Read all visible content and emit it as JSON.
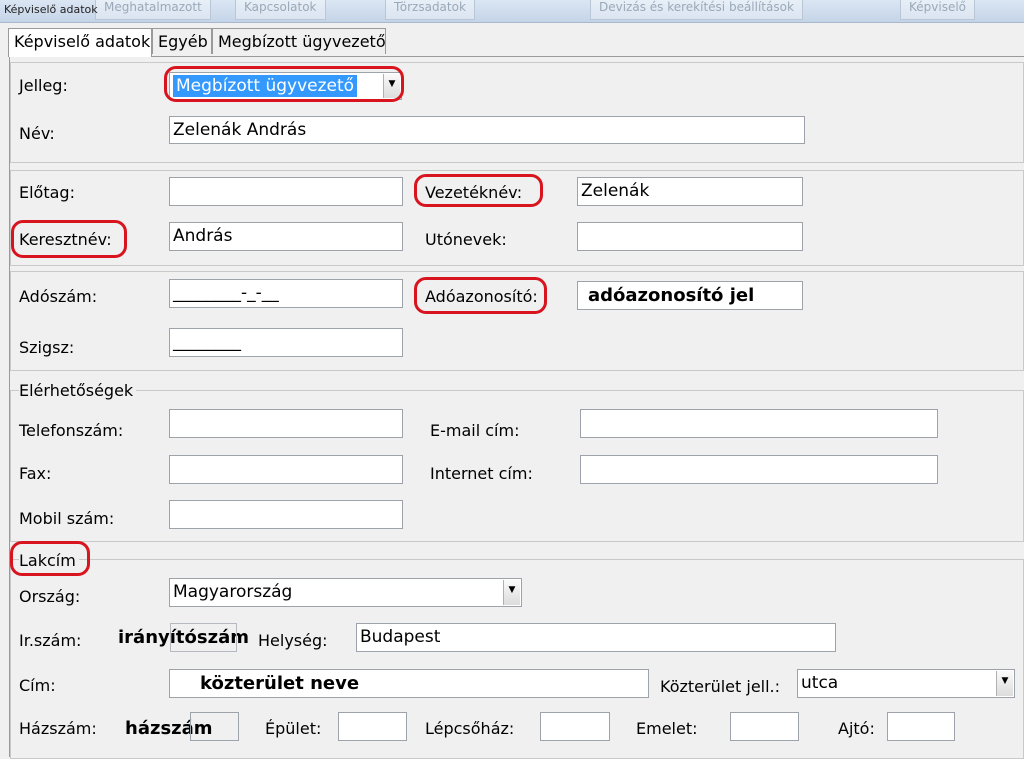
{
  "window": {
    "title": "Képviselő adatok",
    "background_tabs": [
      "Meghatalmazott",
      "Kapcsolatok",
      "Törzsadatok",
      "Devizás és kerekítési beállítások",
      "Képviselő"
    ]
  },
  "tabs": [
    {
      "label": "Képviselő adatok",
      "active": true
    },
    {
      "label": "Egyéb",
      "active": false
    },
    {
      "label": "Megbízott ügyvezető",
      "active": false
    }
  ],
  "general": {
    "jelleg_label": "Jelleg:",
    "jelleg_value": "Megbízott ügyvezető",
    "nev_label": "Név:",
    "nev_value": "Zelenák András"
  },
  "name_parts": {
    "elotag_label": "Előtag:",
    "elotag_value": "",
    "vezeteknev_label": "Vezetéknév:",
    "vezeteknev_value": "Zelenák",
    "keresztnev_label": "Keresztnév:",
    "keresztnev_value": "András",
    "utonevek_label": "Utónevek:",
    "utonevek_value": ""
  },
  "ids": {
    "adoszam_label": "Adószám:",
    "adoszam_value": "________-_-__",
    "adoazonosito_label": "Adóazonosító:",
    "adoazonosito_value": "adóazonosító jel",
    "szigsz_label": "Szigsz:",
    "szigsz_value": "________"
  },
  "contacts": {
    "section_title": "Elérhetőségek",
    "telefon_label": "Telefonszám:",
    "telefon_value": "",
    "email_label": "E-mail cím:",
    "email_value": "",
    "fax_label": "Fax:",
    "fax_value": "",
    "internet_label": "Internet cím:",
    "internet_value": "",
    "mobil_label": "Mobil szám:",
    "mobil_value": ""
  },
  "address": {
    "section_title": "Lakcím",
    "orszag_label": "Ország:",
    "orszag_value": "Magyarország",
    "irszam_label": "Ir.szám:",
    "irszam_value": "irányítószám",
    "helyseg_label": "Helység:",
    "helyseg_value": "Budapest",
    "cim_label": "Cím:",
    "cim_value": "közterület neve",
    "kozterulet_jell_label": "Közterület jell.:",
    "kozterulet_jell_value": "utca",
    "hazszam_label": "Házszám:",
    "hazszam_value": "házszám",
    "epulet_label": "Épület:",
    "epulet_value": "",
    "lepcsohaz_label": "Lépcsőház:",
    "lepcsohaz_value": "",
    "emelet_label": "Emelet:",
    "emelet_value": "",
    "ajto_label": "Ajtó:",
    "ajto_value": ""
  },
  "colors": {
    "highlight": "#d8141e",
    "selection": "#3399ff"
  }
}
